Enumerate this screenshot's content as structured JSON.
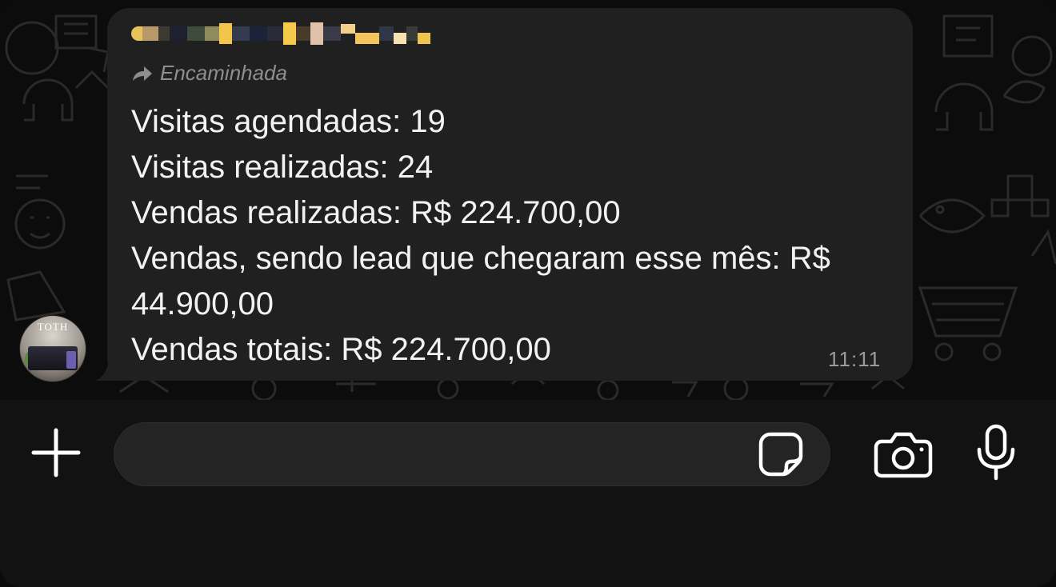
{
  "message": {
    "sender_name_redacted": "",
    "forwarded_label": "Encaminhada",
    "lines": [
      "Visitas agendadas: 19",
      "Visitas realizadas: 24",
      "Vendas realizadas: R$ 224.700,00",
      "Vendas, sendo lead que chegaram esse mês: R$",
      "44.900,00",
      "Vendas totais: R$ 224.700,00"
    ],
    "time": "11:11"
  },
  "avatar": {
    "brand_text": "TOTH"
  },
  "composer": {
    "input_value": "",
    "input_placeholder": ""
  },
  "icons": {
    "forward": "forward-arrow-icon",
    "plus": "plus-icon",
    "sticker": "sticker-icon",
    "camera": "camera-icon",
    "mic": "microphone-icon"
  },
  "colors": {
    "background": "#0c0c0c",
    "bubble": "#202020",
    "text": "#f2f2f2",
    "meta_text": "#9a9a9a",
    "input_bar": "#121212",
    "input_field": "#242424"
  }
}
